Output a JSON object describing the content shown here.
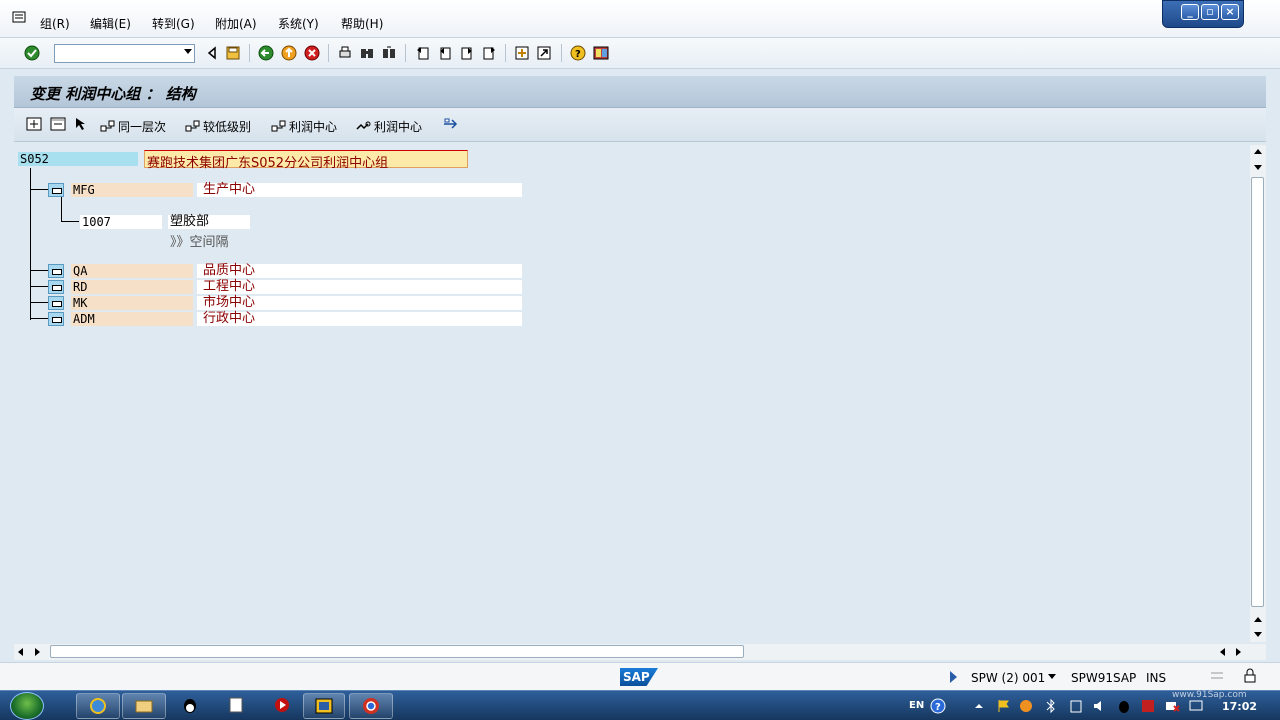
{
  "menu": {
    "items": [
      "组(R)",
      "编辑(E)",
      "转到(G)",
      "附加(A)",
      "系统(Y)",
      "帮助(H)"
    ]
  },
  "toolbar": {
    "command_value": ""
  },
  "title": "变更 利润中心组 ： 结构",
  "app_toolbar": {
    "buttons": [
      "同一层次",
      "较低级别",
      "利润中心",
      "利润中心"
    ]
  },
  "tree": {
    "root": {
      "key": "S052",
      "text": "赛跑技术集团广东S052分公司利润中心组"
    },
    "mfg": {
      "key": "MFG",
      "text": "生产中心"
    },
    "child": {
      "key": "1007",
      "text": "塑胶部"
    },
    "empty": "》》空间隔",
    "others": [
      {
        "key": "QA",
        "text": "品质中心"
      },
      {
        "key": "RD",
        "text": "工程中心"
      },
      {
        "key": "MK",
        "text": "市场中心"
      },
      {
        "key": "ADM",
        "text": "行政中心"
      }
    ]
  },
  "status": {
    "session": "SPW (2) 001",
    "server": "SPW91SAP",
    "mode": "INS"
  },
  "taskbar": {
    "lang": "EN",
    "clock": "17:02",
    "watermark": "www.91Sap.com"
  },
  "colors": {
    "accent": "#8b0000",
    "key_bg_root": "#a8e0f0",
    "key_bg_node": "#f7e0c8"
  }
}
